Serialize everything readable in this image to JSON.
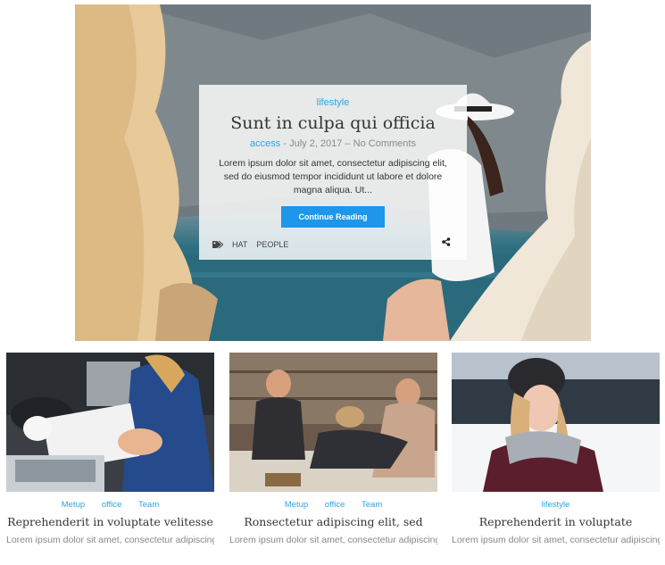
{
  "featured": {
    "category": "lifestyle",
    "title": "Sunt in culpa qui officia",
    "author": "access",
    "separator": "-",
    "date": "July 2, 2017",
    "dash": "–",
    "comments": "No Comments",
    "excerpt": "Lorem ipsum dolor sit amet, consectetur adipiscing elit, sed do eiusmod tempor incididunt ut labore et dolore magna aliqua. Ut...",
    "button_label": "Continue Reading",
    "tags": [
      "HAT",
      "PEOPLE"
    ],
    "icons": {
      "tag": "tag-icon",
      "share": "share-icon"
    }
  },
  "posts": [
    {
      "categories": [
        "Metup",
        "office",
        "Team"
      ],
      "title": "Reprehenderit in voluptate velitesse",
      "excerpt": "Lorem ipsum dolor sit amet, consectetur adipiscing elit, sed do eiusmod tempor incididunt..."
    },
    {
      "categories": [
        "Metup",
        "office",
        "Team"
      ],
      "title": "Ronsectetur adipiscing elit, sed",
      "excerpt": "Lorem ipsum dolor sit amet, consectetur adipiscing elit, sed do eiusmod tempor incididunt..."
    },
    {
      "categories": [
        "lifestyle"
      ],
      "title": "Reprehenderit in voluptate",
      "excerpt": "Lorem ipsum dolor sit amet, consectetur adipiscing elit, sed do eiusmod tempor incididunt..."
    }
  ],
  "colors": {
    "accent": "#2da4e0",
    "button": "#1e96ea"
  }
}
